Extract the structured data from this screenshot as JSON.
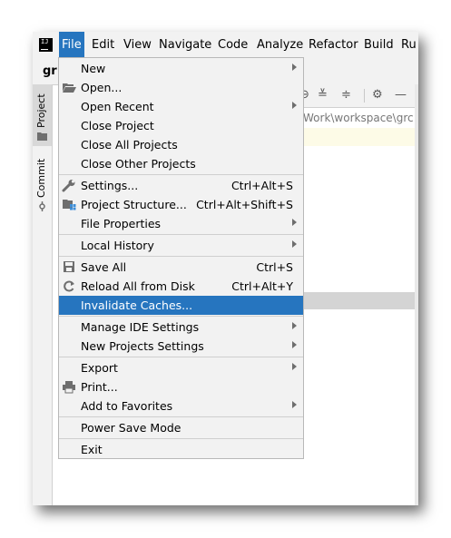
{
  "menubar": {
    "logo_text": "IJ",
    "items": [
      {
        "label": "File"
      },
      {
        "label": "Edit"
      },
      {
        "label": "View"
      },
      {
        "label": "Navigate"
      },
      {
        "label": "Code"
      },
      {
        "label": "Analyze"
      },
      {
        "label": "Refactor"
      },
      {
        "label": "Build"
      },
      {
        "label": "Ru"
      }
    ]
  },
  "toolbar": {
    "project_name": "gr"
  },
  "side_tabs": [
    {
      "label": "Project"
    },
    {
      "label": "Commit"
    }
  ],
  "tool_panel": {
    "path_text": "Work\\workspace\\grc"
  },
  "file_menu": {
    "items": [
      {
        "label": "New",
        "shortcut": "",
        "submenu": true
      },
      {
        "label": "Open...",
        "shortcut": "",
        "submenu": false,
        "icon": "folder-icon"
      },
      {
        "label": "Open Recent",
        "shortcut": "",
        "submenu": true
      },
      {
        "label": "Close Project",
        "shortcut": "",
        "submenu": false
      },
      {
        "label": "Close All Projects",
        "shortcut": "",
        "submenu": false
      },
      {
        "label": "Close Other Projects",
        "shortcut": "",
        "submenu": false
      },
      {
        "label": "Settings...",
        "shortcut": "Ctrl+Alt+S",
        "submenu": false,
        "icon": "wrench-icon"
      },
      {
        "label": "Project Structure...",
        "shortcut": "Ctrl+Alt+Shift+S",
        "submenu": false,
        "icon": "project-structure-icon"
      },
      {
        "label": "File Properties",
        "shortcut": "",
        "submenu": true
      },
      {
        "label": "Local History",
        "shortcut": "",
        "submenu": true
      },
      {
        "label": "Save All",
        "shortcut": "Ctrl+S",
        "submenu": false,
        "icon": "save-icon"
      },
      {
        "label": "Reload All from Disk",
        "shortcut": "Ctrl+Alt+Y",
        "submenu": false,
        "icon": "reload-icon"
      },
      {
        "label": "Invalidate Caches...",
        "shortcut": "",
        "submenu": false,
        "selected": true
      },
      {
        "label": "Manage IDE Settings",
        "shortcut": "",
        "submenu": true
      },
      {
        "label": "New Projects Settings",
        "shortcut": "",
        "submenu": true
      },
      {
        "label": "Export",
        "shortcut": "",
        "submenu": true
      },
      {
        "label": "Print...",
        "shortcut": "",
        "submenu": false,
        "icon": "printer-icon"
      },
      {
        "label": "Add to Favorites",
        "shortcut": "",
        "submenu": true
      },
      {
        "label": "Power Save Mode",
        "shortcut": "",
        "submenu": false
      },
      {
        "label": "Exit",
        "shortcut": "",
        "submenu": false
      }
    ]
  },
  "colors": {
    "accent": "#2675bf",
    "menu_bg": "#f2f2f2"
  }
}
